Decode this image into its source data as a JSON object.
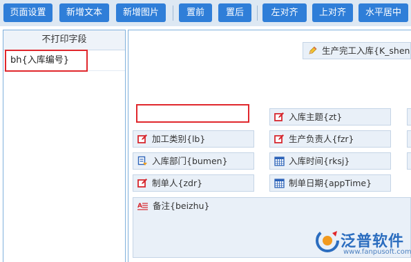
{
  "toolbar": {
    "buttons": [
      "页面设置",
      "新增文本",
      "新增图片",
      "置前",
      "置后",
      "左对齐",
      "上对齐",
      "水平居中"
    ]
  },
  "left_panel": {
    "header": "不打印字段",
    "items": [
      "bh{入库编号}"
    ]
  },
  "canvas": {
    "title_field": "生产完工入库{K_sheng",
    "fields": {
      "subject": "入库主题{zt}",
      "process_type": "加工类别{lb}",
      "responsible": "生产负责人{fzr}",
      "department": "入库部门{bumen}",
      "time": "入库时间{rksj}",
      "creator": "制单人{zdr}",
      "create_date": "制单日期{appTime}",
      "remark": "备注{beizhu}"
    }
  },
  "logo": {
    "name": "泛普软件",
    "url": "www.fanpusoft.com"
  },
  "colors": {
    "button_blue": "#2f7ed8",
    "toolbar_bg": "#dde8f3",
    "field_bg": "#e9f0f8",
    "highlight_red": "#e0262b",
    "logo_blue": "#2b6dbf"
  },
  "icons": {
    "title_field": "pencil-icon",
    "edit_fields": "edit-icon",
    "department": "list-icon",
    "date_fields": "calendar-icon",
    "remark": "text-icon"
  }
}
